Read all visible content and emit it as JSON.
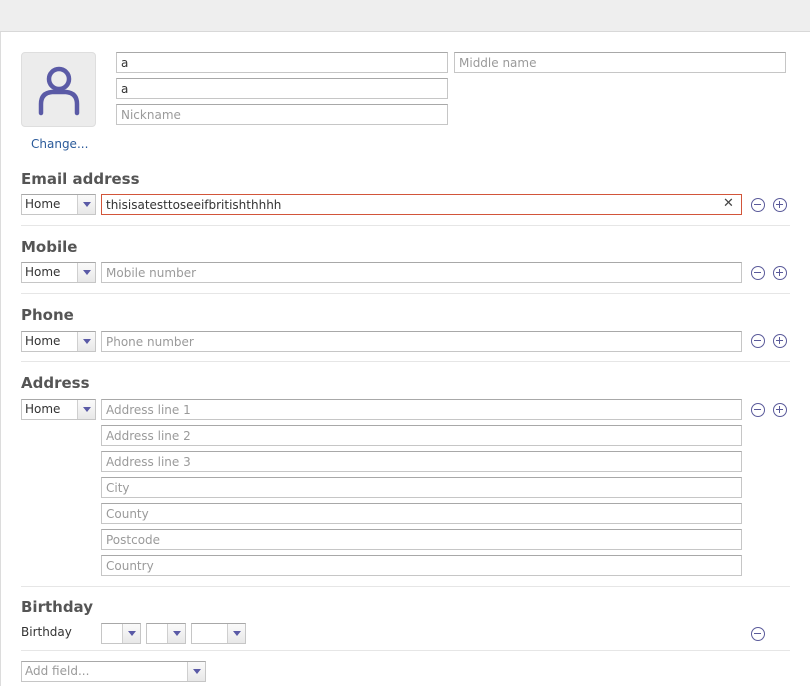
{
  "name": {
    "first_value": "a",
    "middle_placeholder": "Middle name",
    "last_value": "a",
    "nickname_placeholder": "Nickname"
  },
  "photo": {
    "change_label": "Change..."
  },
  "email": {
    "title": "Email address",
    "type": "Home",
    "value": "thisisatesttoseeifbritishthhhh"
  },
  "mobile": {
    "title": "Mobile",
    "type": "Home",
    "placeholder": "Mobile number"
  },
  "phone": {
    "title": "Phone",
    "type": "Home",
    "placeholder": "Phone number"
  },
  "address": {
    "title": "Address",
    "type": "Home",
    "line1_placeholder": "Address line 1",
    "line2_placeholder": "Address line 2",
    "line3_placeholder": "Address line 3",
    "city_placeholder": "City",
    "county_placeholder": "County",
    "postcode_placeholder": "Postcode",
    "country_placeholder": "Country"
  },
  "birthday": {
    "title": "Birthday",
    "label": "Birthday",
    "day": "",
    "month": "",
    "year": ""
  },
  "add_field": {
    "placeholder": "Add field..."
  },
  "colors": {
    "accent": "#5a5a9a",
    "error_border": "#d2553a",
    "link": "#2a5a9a"
  }
}
